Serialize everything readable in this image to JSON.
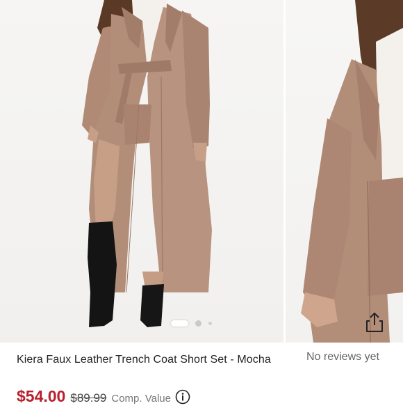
{
  "product": {
    "title": "Kiera Faux Leather Trench Coat Short Set - Mocha",
    "reviews_text": "No reviews yet",
    "price": "$54.00",
    "original_price": "$89.99",
    "comp_label": "Comp. Value"
  },
  "gallery": {
    "image_count": 3,
    "active_index": 0
  },
  "colors": {
    "price": "#b7202e",
    "coat": "#b28d78",
    "boots": "#141414"
  },
  "icons": {
    "share": "share-icon",
    "info": "info-icon"
  }
}
